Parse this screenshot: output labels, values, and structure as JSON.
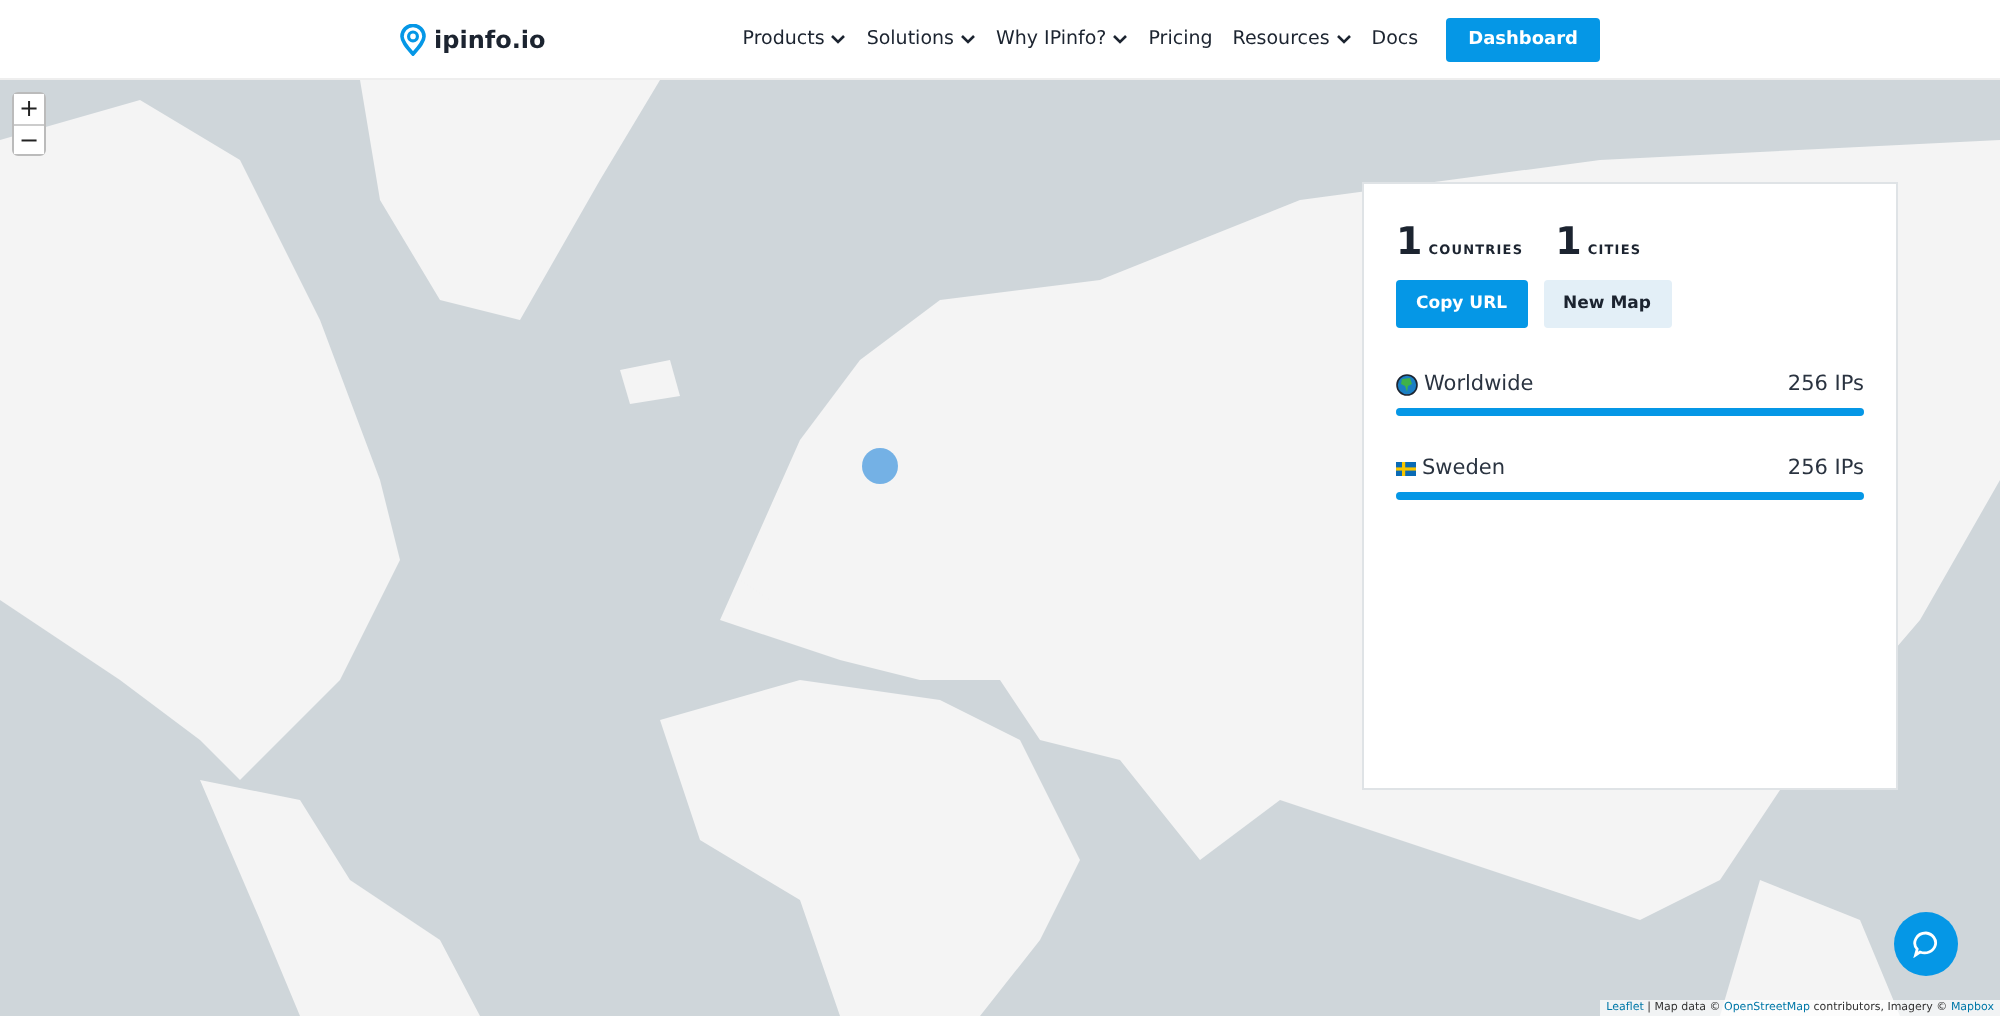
{
  "header": {
    "logo": "ipinfo.io",
    "nav": [
      {
        "label": "Products",
        "dropdown": true
      },
      {
        "label": "Solutions",
        "dropdown": true
      },
      {
        "label": "Why IPinfo?",
        "dropdown": true
      },
      {
        "label": "Pricing",
        "dropdown": false
      },
      {
        "label": "Resources",
        "dropdown": true
      },
      {
        "label": "Docs",
        "dropdown": false
      }
    ],
    "cta": "Dashboard"
  },
  "map": {
    "zoom_in": "+",
    "zoom_out": "−",
    "attribution": [
      {
        "text": "Leaflet",
        "link": true
      },
      {
        "text": " | Map data © ",
        "link": false
      },
      {
        "text": "OpenStreetMap",
        "link": true
      },
      {
        "text": " contributors, Imagery © ",
        "link": false
      },
      {
        "text": "Mapbox",
        "link": true
      }
    ]
  },
  "panel": {
    "stats": [
      {
        "value": "1",
        "label": "COUNTRIES"
      },
      {
        "value": "1",
        "label": "CITIES"
      }
    ],
    "buttons": [
      {
        "label": "Copy URL",
        "kind": "primary"
      },
      {
        "label": "New Map",
        "kind": "secondary"
      }
    ],
    "locations": [
      {
        "kind": "globe",
        "name": "Worldwide",
        "count": "256 IPs",
        "level": 1
      },
      {
        "kind": "flag",
        "name": "Sweden",
        "count": "256 IPs",
        "level": 1
      }
    ]
  }
}
